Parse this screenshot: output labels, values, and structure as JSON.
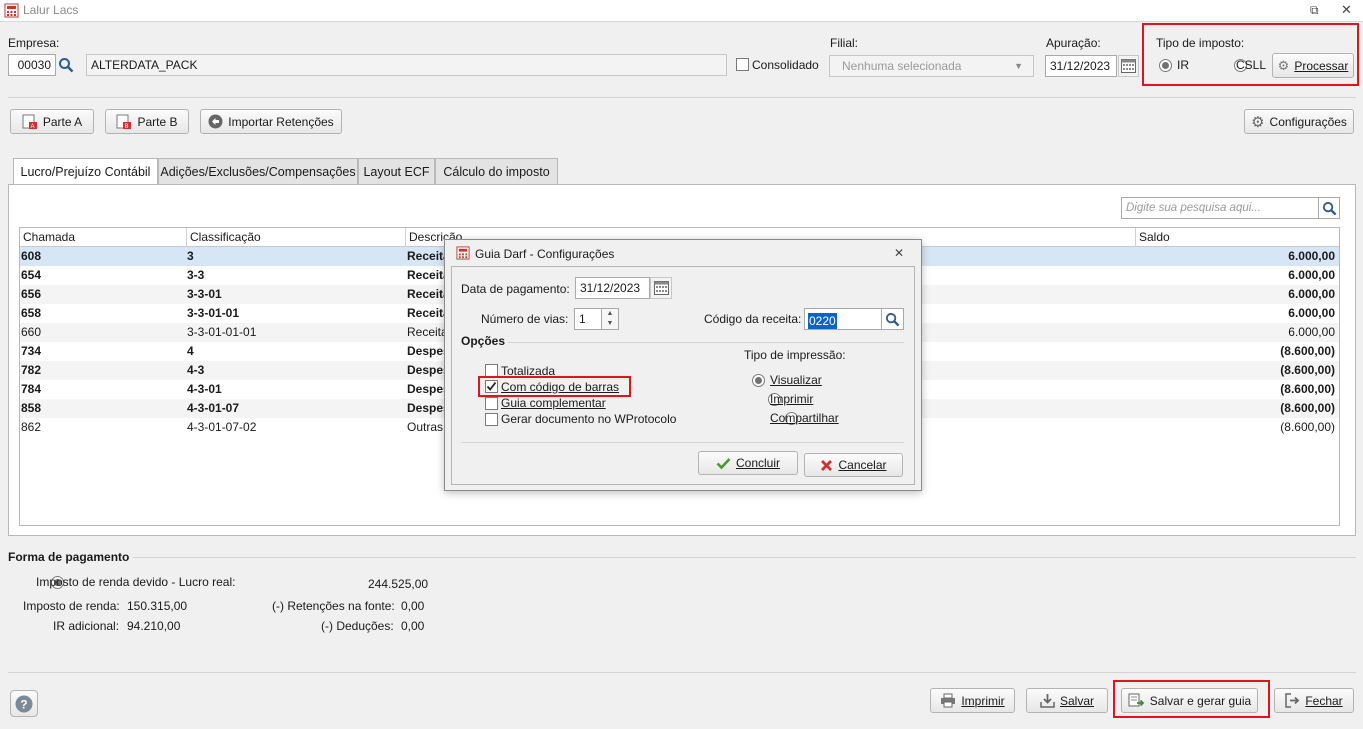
{
  "window": {
    "title": "Lalur Lacs"
  },
  "header": {
    "empresa_label": "Empresa:",
    "empresa_code": "00030",
    "empresa_name": "ALTERDATA_PACK",
    "consolidado_label": "Consolidado",
    "filial_label": "Filial:",
    "filial_value": "Nenhuma selecionada",
    "apuracao_label": "Apuração:",
    "apuracao_value": "31/12/2023",
    "tipo_imposto_label": "Tipo de imposto:",
    "tipo_ir": "IR",
    "tipo_csll": "CSLL",
    "processar_label": "Processar"
  },
  "toolbar": {
    "parte_a": "Parte A",
    "parte_b": "Parte B",
    "importar": "Importar Retenções",
    "configuracoes": "Configurações"
  },
  "tabs": [
    {
      "label": "Lucro/Prejuízo Contábil"
    },
    {
      "label": "Adições/Exclusões/Compensações"
    },
    {
      "label": "Layout ECF"
    },
    {
      "label": "Cálculo do imposto"
    }
  ],
  "search": {
    "placeholder": "Digite sua pesquisa aqui..."
  },
  "grid": {
    "columns": [
      "Chamada",
      "Classificação",
      "Descrição",
      "Saldo"
    ],
    "rows": [
      {
        "chamada": "608",
        "classificacao": "3",
        "descricao": "Receita",
        "saldo": "6.000,00",
        "bold": true
      },
      {
        "chamada": "654",
        "classificacao": "3-3",
        "descricao": "Receita",
        "saldo": "6.000,00",
        "bold": true
      },
      {
        "chamada": "656",
        "classificacao": "3-3-01",
        "descricao": "Receita",
        "saldo": "6.000,00",
        "bold": true
      },
      {
        "chamada": "658",
        "classificacao": "3-3-01-01",
        "descricao": "Receita",
        "saldo": "6.000,00",
        "bold": true
      },
      {
        "chamada": "660",
        "classificacao": "3-3-01-01-01",
        "descricao": "Receita",
        "saldo": "6.000,00",
        "bold": false
      },
      {
        "chamada": "734",
        "classificacao": "4",
        "descricao": "Despes",
        "saldo": "(8.600,00)",
        "bold": true
      },
      {
        "chamada": "782",
        "classificacao": "4-3",
        "descricao": "Despes",
        "saldo": "(8.600,00)",
        "bold": true
      },
      {
        "chamada": "784",
        "classificacao": "4-3-01",
        "descricao": "Despes",
        "saldo": "(8.600,00)",
        "bold": true
      },
      {
        "chamada": "858",
        "classificacao": "4-3-01-07",
        "descricao": "Despes",
        "saldo": "(8.600,00)",
        "bold": true
      },
      {
        "chamada": "862",
        "classificacao": "4-3-01-07-02",
        "descricao": "Outras",
        "saldo": "(8.600,00)",
        "bold": false
      }
    ]
  },
  "payment": {
    "section_title": "Forma de pagamento",
    "imposto_devido_label": "Imposto de renda devido - Lucro real:",
    "imposto_devido_value": "244.525,00",
    "imposto_renda_label": "Imposto de renda:",
    "imposto_renda_value": "150.315,00",
    "ir_adicional_label": "IR adicional:",
    "ir_adicional_value": "94.210,00",
    "retencoes_label": "(-) Retenções na fonte:",
    "retencoes_value": "0,00",
    "deducoes_label": "(-) Deduções:",
    "deducoes_value": "0,00"
  },
  "footer": {
    "imprimir": "Imprimir",
    "salvar": "Salvar",
    "salvar_gerar": "Salvar e gerar guia",
    "fechar": "Fechar"
  },
  "dialog": {
    "title": "Guia Darf - Configurações",
    "data_pagamento_label": "Data de pagamento:",
    "data_pagamento_value": "31/12/2023",
    "num_vias_label": "Número de vias:",
    "num_vias_value": "1",
    "codigo_receita_label": "Código da receita:",
    "codigo_receita_value": "0220",
    "opcoes_label": "Opções",
    "options": [
      {
        "label": "Totalizada",
        "checked": false
      },
      {
        "label": "Com código de barras",
        "checked": true
      },
      {
        "label": "Guia complementar",
        "checked": false
      },
      {
        "label": "Gerar documento no WProtocolo",
        "checked": false
      }
    ],
    "tipo_impressao_label": "Tipo de impressão:",
    "print_types": [
      {
        "label": "Visualizar",
        "selected": true
      },
      {
        "label": "Imprimir",
        "selected": false
      },
      {
        "label": "Compartilhar",
        "selected": false
      }
    ],
    "concluir": "Concluir",
    "cancelar": "Cancelar"
  },
  "colors": {
    "highlight_red": "#e0141d",
    "selected_row": "#d7e6f7",
    "alt_row": "#f4f4f4",
    "check_green": "#4a9a2c",
    "cancel_red": "#d32f2f"
  }
}
